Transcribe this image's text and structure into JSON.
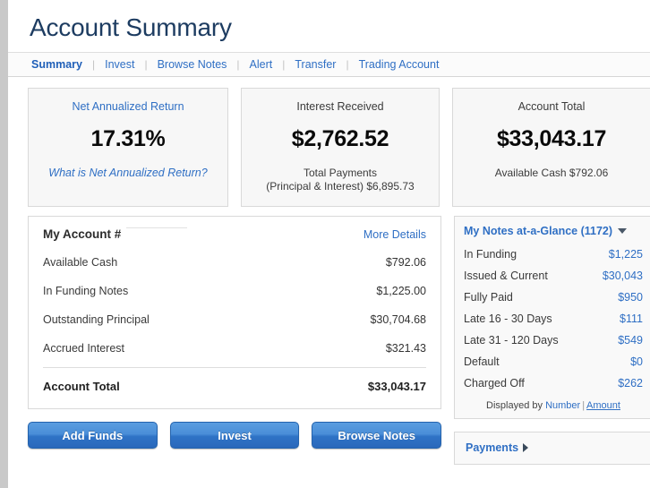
{
  "header": {
    "title": "Account Summary"
  },
  "nav": {
    "items": [
      {
        "label": "Summary",
        "active": true
      },
      {
        "label": "Invest",
        "active": false
      },
      {
        "label": "Browse Notes",
        "active": false
      },
      {
        "label": "Alert",
        "active": false
      },
      {
        "label": "Transfer",
        "active": false
      },
      {
        "label": "Trading Account",
        "active": false
      }
    ],
    "separator": "|"
  },
  "cards": [
    {
      "label": "Net Annualized Return",
      "value": "17.31%",
      "sub": "What is Net Annualized Return?"
    },
    {
      "label": "Interest Received",
      "value": "$2,762.52",
      "sub_line1": "Total Payments",
      "sub_line2": "(Principal & Interest) $6,895.73"
    },
    {
      "label": "Account Total",
      "value": "$33,043.17",
      "sub": "Available Cash $792.06"
    }
  ],
  "account_panel": {
    "title": "My Account #",
    "more_details": "More Details",
    "rows": [
      {
        "label": "Available Cash",
        "value": "$792.06"
      },
      {
        "label": "In Funding Notes",
        "value": "$1,225.00"
      },
      {
        "label": "Outstanding Principal",
        "value": "$30,704.68"
      },
      {
        "label": "Accrued Interest",
        "value": "$321.43"
      }
    ],
    "total": {
      "label": "Account Total",
      "value": "$33,043.17"
    }
  },
  "buttons": [
    {
      "label": "Add Funds"
    },
    {
      "label": "Invest"
    },
    {
      "label": "Browse Notes"
    }
  ],
  "notes_panel": {
    "title": "My Notes at-a-Glance (1172)",
    "rows": [
      {
        "label": "In Funding",
        "value": "$1,225"
      },
      {
        "label": "Issued & Current",
        "value": "$30,043"
      },
      {
        "label": "Fully Paid",
        "value": "$950"
      },
      {
        "label": "Late 16 - 30 Days",
        "value": "$111"
      },
      {
        "label": "Late 31 - 120 Days",
        "value": "$549"
      },
      {
        "label": "Default",
        "value": "$0"
      },
      {
        "label": "Charged Off",
        "value": "$262"
      }
    ],
    "footer": {
      "prefix": "Displayed by",
      "option_number": "Number",
      "separator": "|",
      "option_amount": "Amount",
      "selected": "Amount"
    }
  },
  "payments_panel": {
    "title": "Payments"
  },
  "colors": {
    "link": "#2f6fc4",
    "title": "#1d3c61",
    "button": "#2f73c6",
    "card_bg": "#f7f7f7",
    "border": "#d9d9d9"
  }
}
